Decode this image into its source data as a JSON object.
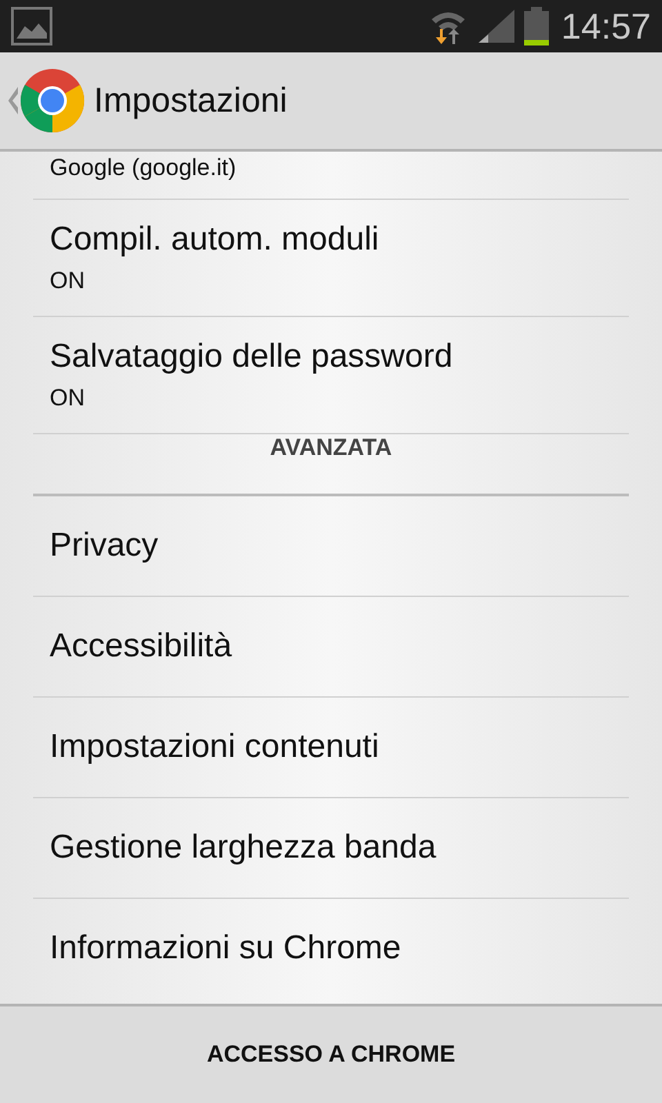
{
  "status_bar": {
    "time": "14:57"
  },
  "action_bar": {
    "title": "Impostazioni"
  },
  "items": [
    {
      "kind": "summary",
      "summary": "Google (google.it)"
    },
    {
      "kind": "pref",
      "title": "Compil. autom. moduli",
      "summary": "ON"
    },
    {
      "kind": "pref",
      "title": "Salvataggio delle password",
      "summary": "ON"
    },
    {
      "kind": "header",
      "title": "AVANZATA"
    },
    {
      "kind": "link",
      "title": "Privacy"
    },
    {
      "kind": "link",
      "title": "Accessibilità"
    },
    {
      "kind": "link",
      "title": "Impostazioni contenuti"
    },
    {
      "kind": "link",
      "title": "Gestione larghezza banda"
    },
    {
      "kind": "link",
      "title": "Informazioni su Chrome"
    }
  ],
  "bottom_button": "ACCESSO A CHROME"
}
